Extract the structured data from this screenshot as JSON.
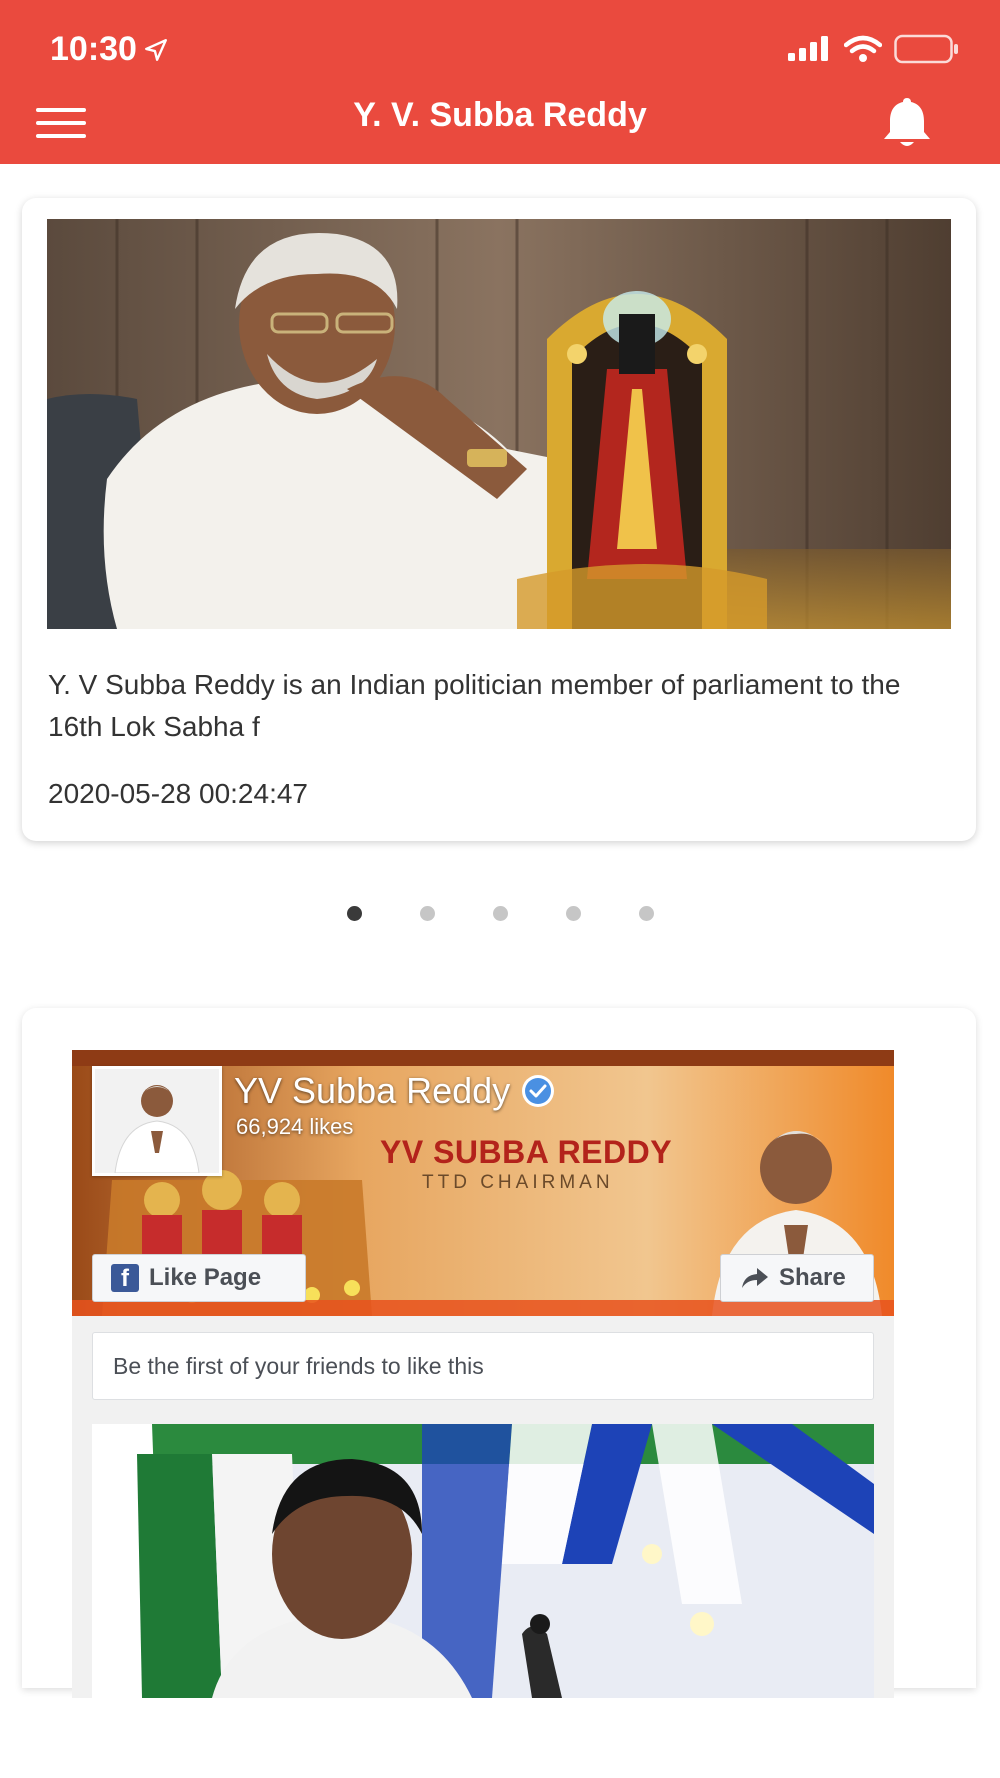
{
  "status_bar": {
    "time": "10:30",
    "location_icon": "location-arrow-icon",
    "signal_icon": "cellular-signal-icon",
    "wifi_icon": "wifi-icon",
    "battery_icon": "battery-icon"
  },
  "header": {
    "title": "Y. V. Subba Reddy",
    "menu_icon": "hamburger-menu-icon",
    "notification_icon": "bell-icon",
    "background_color": "#ea4a3e"
  },
  "news_card": {
    "description": "Y. V Subba Reddy is an Indian politician member of parliament to the 16th Lok Sabha f",
    "timestamp": "2020-05-28 00:24:47"
  },
  "carousel": {
    "total_pages": 5,
    "active_page": 1
  },
  "facebook_widget": {
    "page_name": "YV Subba Reddy",
    "verified_icon": "verified-badge-icon",
    "likes": "66,924 likes",
    "banner_title": "YV SUBBA REDDY",
    "banner_subtitle": "TTD CHAIRMAN",
    "like_button": "Like Page",
    "share_button": "Share",
    "friends_text": "Be the first of your friends to like this",
    "brand_color": "#3b5998"
  }
}
